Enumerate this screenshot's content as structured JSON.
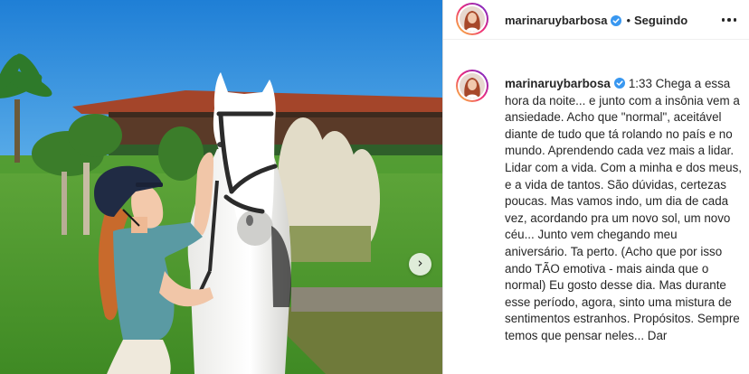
{
  "post": {
    "username": "marinaruybarbosa",
    "separator": "•",
    "follow_state": "Seguindo",
    "caption": "1:33 Chega a essa hora da noite... e junto com a insônia vem a ansiedade. Acho que \"normal\", aceitável diante de tudo que tá rolando no país e no mundo. Aprendendo cada vez mais a lidar. Lidar com a vida. Com a minha e dos meus, e a vida de tantos. São dúvidas, certezas poucas. Mas vamos indo, um dia de cada vez, acordando pra um novo sol, um novo céu... Junto vem chegando meu aniversário. Ta perto. (Acho que por isso ando TÃO emotiva - mais ainda que o normal) Eu gosto desse dia. Mas durante esse período, agora, sinto uma mistura de sentimentos estranhos. Propósitos. Sempre temos que pensar neles... Dar"
  },
  "icons": {
    "verified": "verified-badge-icon",
    "more": "more-options-icon",
    "next": "chevron-right-icon"
  },
  "colors": {
    "text": "#262626",
    "verified_blue": "#3897f0",
    "sky": "#2f8fd9",
    "border": "#dbdbdb"
  }
}
